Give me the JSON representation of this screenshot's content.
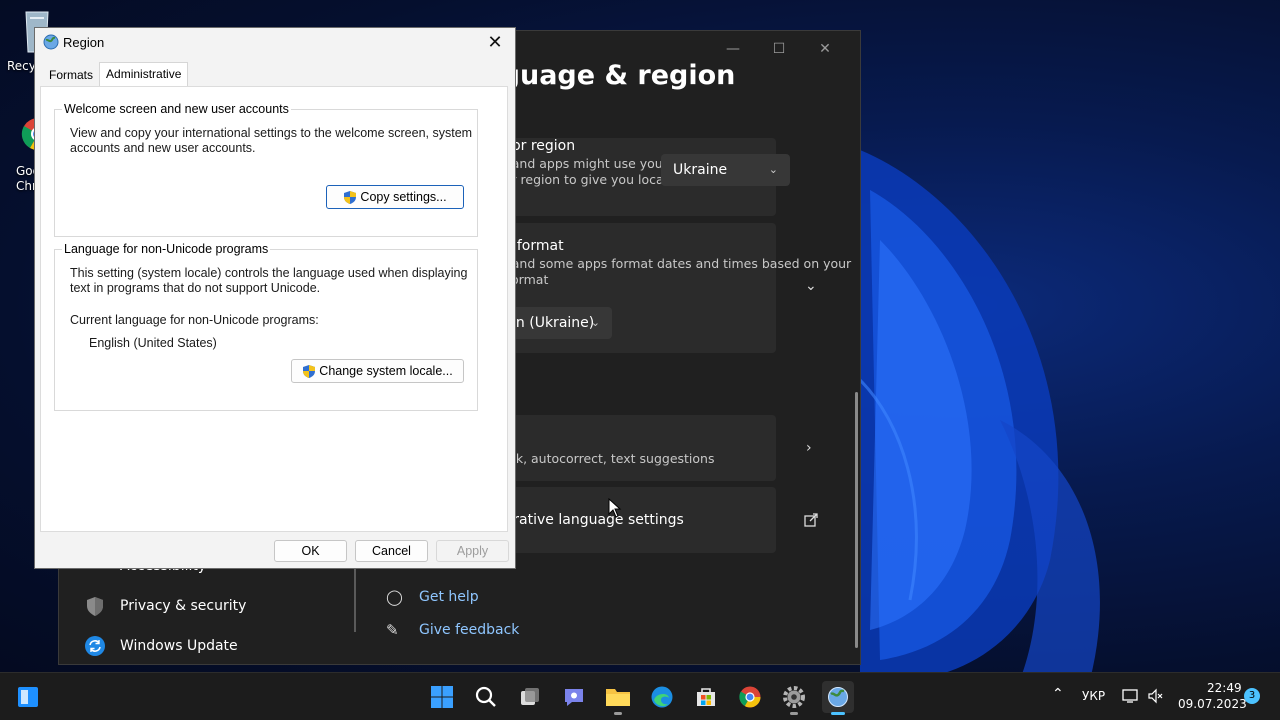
{
  "desktop": {
    "icons": [
      {
        "label": "Recycle Bin"
      },
      {
        "label": "Google Chrome"
      }
    ]
  },
  "settings": {
    "title": "Language & region",
    "country": {
      "title": "Country or region",
      "desc_line1": "Windows and apps might use your",
      "desc_line2": "country or region to give you local",
      "value": "Ukraine"
    },
    "format": {
      "title": "Regional format",
      "desc_line1": "Windows and some apps format dates and times based on your",
      "desc_line2": "regional format",
      "value": "Ukrainian (Ukraine)"
    },
    "typing": {
      "desc": "Spell check, autocorrect, text suggestions"
    },
    "admin": {
      "title": "Administrative language settings"
    },
    "nav": [
      {
        "label": "Accessibility",
        "icon": "accessibility-icon"
      },
      {
        "label": "Privacy & security",
        "icon": "shield-icon"
      },
      {
        "label": "Windows Update",
        "icon": "update-icon"
      }
    ],
    "help": {
      "get_help": "Get help",
      "give_feedback": "Give feedback"
    }
  },
  "dialog": {
    "title": "Region",
    "tabs": [
      "Formats",
      "Administrative"
    ],
    "active_tab": "Administrative",
    "welcome": {
      "legend": "Welcome screen and new user accounts",
      "text_line1": "View and copy your international settings to the welcome screen, system",
      "text_line2": "accounts and new user accounts.",
      "button": "Copy settings..."
    },
    "nonunicode": {
      "legend": "Language for non-Unicode programs",
      "text_line1": "This setting (system locale) controls the language used when displaying",
      "text_line2": "text in programs that do not support Unicode.",
      "current_label": "Current language for non-Unicode programs:",
      "current_value": "English (United States)",
      "button": "Change system locale..."
    },
    "buttons": {
      "ok": "OK",
      "cancel": "Cancel",
      "apply": "Apply"
    }
  },
  "taskbar": {
    "language": "УКР",
    "time": "22:49",
    "date": "09.07.2023",
    "notification_count": "3"
  }
}
